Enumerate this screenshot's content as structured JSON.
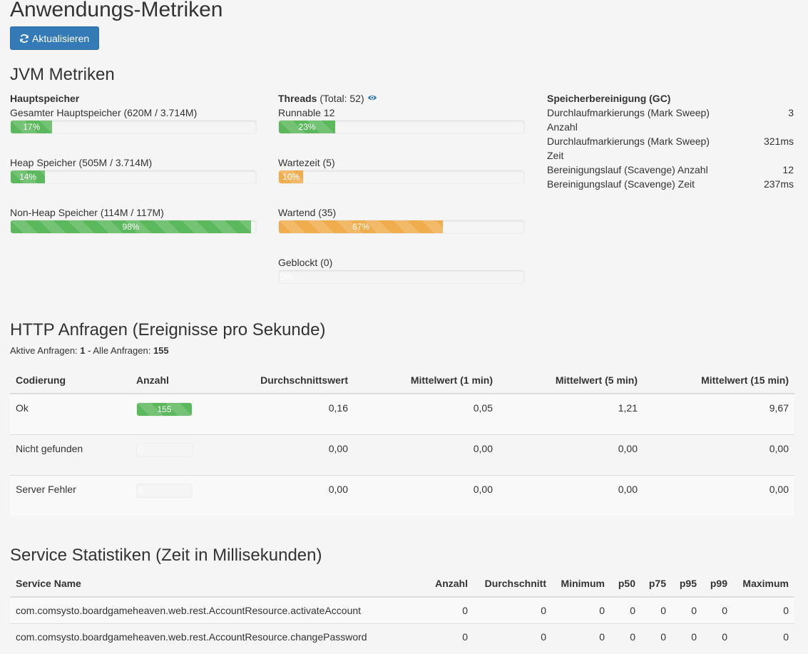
{
  "page": {
    "title": "Anwendungs-Metriken",
    "refresh_label": "Aktualisieren"
  },
  "jvm": {
    "title": "JVM Metriken",
    "memory": {
      "heading": "Hauptspeicher",
      "items": [
        {
          "label": "Gesamter Hauptspeicher (620M / 3.714M)",
          "percent": 17,
          "text": "17%"
        },
        {
          "label": "Heap Speicher (505M / 3.714M)",
          "percent": 14,
          "text": "14%"
        },
        {
          "label": "Non-Heap Speicher (114M / 117M)",
          "percent": 98,
          "text": "98%"
        }
      ]
    },
    "threads": {
      "heading": "Threads",
      "total": "(Total: 52)",
      "items": [
        {
          "label": "Runnable 12",
          "percent": 23,
          "text": "23%",
          "color": "green"
        },
        {
          "label": "Wartezeit (5)",
          "percent": 10,
          "text": "10%",
          "color": "orange"
        },
        {
          "label": "Wartend (35)",
          "percent": 67,
          "text": "67%",
          "color": "orange"
        },
        {
          "label": "Geblockt (0)",
          "percent": 0,
          "text": "0%",
          "color": "empty"
        }
      ]
    },
    "gc": {
      "heading": "Speicherbereinigung (GC)",
      "items": [
        {
          "label": "Durchlaufmarkierungs (Mark Sweep) Anzahl",
          "value": "3"
        },
        {
          "label": "Durchlaufmarkierungs (Mark Sweep) Zeit",
          "value": "321ms"
        },
        {
          "label": "Bereinigungslauf (Scavenge) Anzahl",
          "value": "12"
        },
        {
          "label": "Bereinigungslauf (Scavenge) Zeit",
          "value": "237ms"
        }
      ]
    }
  },
  "http": {
    "title": "HTTP Anfragen (Ereignisse pro Sekunde)",
    "active_label": "Aktive Anfragen:",
    "active_value": "1",
    "all_label": "- Alle Anfragen:",
    "all_value": "155",
    "headers": [
      "Codierung",
      "Anzahl",
      "Durchschnittswert",
      "Mittelwert (1 min)",
      "Mittelwert (5 min)",
      "Mittelwert (15 min)"
    ],
    "rows": [
      {
        "code": "Ok",
        "count": 155,
        "count_text": "155",
        "avg": "0,16",
        "m1": "0,05",
        "m5": "1,21",
        "m15": "9,67"
      },
      {
        "code": "Nicht gefunden",
        "count": 0,
        "count_text": "0",
        "avg": "0,00",
        "m1": "0,00",
        "m5": "0,00",
        "m15": "0,00"
      },
      {
        "code": "Server Fehler",
        "count": 0,
        "count_text": "0",
        "avg": "0,00",
        "m1": "0,00",
        "m5": "0,00",
        "m15": "0,00"
      }
    ]
  },
  "services": {
    "title": "Service Statistiken (Zeit in Millisekunden)",
    "headers": [
      "Service Name",
      "Anzahl",
      "Durchschnitt",
      "Minimum",
      "p50",
      "p75",
      "p95",
      "p99",
      "Maximum"
    ],
    "rows": [
      [
        "com.comsysto.boardgameheaven.web.rest.AccountResource.activateAccount",
        "0",
        "0",
        "0",
        "0",
        "0",
        "0",
        "0",
        "0"
      ],
      [
        "com.comsysto.boardgameheaven.web.rest.AccountResource.changePassword",
        "0",
        "0",
        "0",
        "0",
        "0",
        "0",
        "0",
        "0"
      ]
    ]
  }
}
